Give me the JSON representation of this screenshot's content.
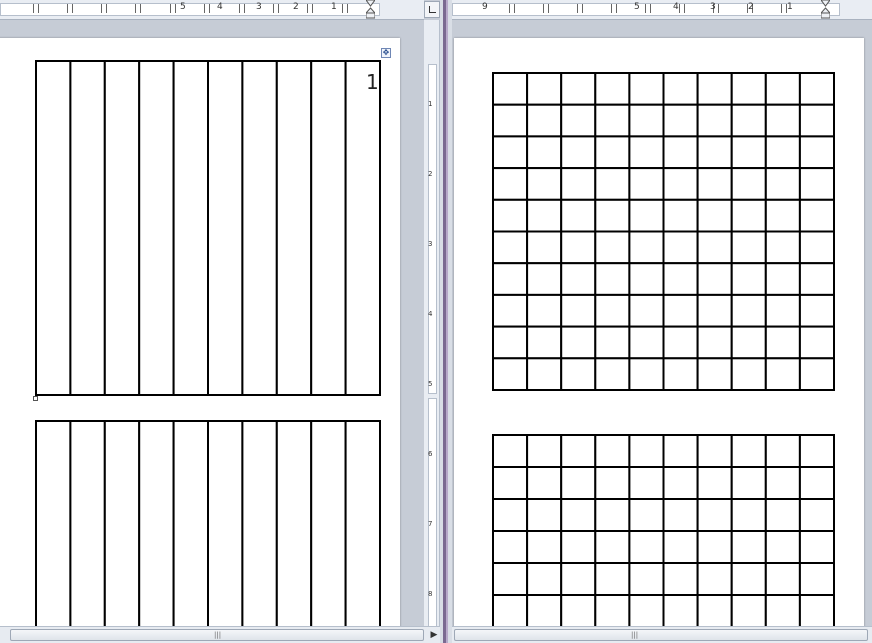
{
  "left_ruler": {
    "numbers": [
      "5",
      "4",
      "3",
      "2",
      "1"
    ]
  },
  "right_ruler": {
    "numbers": [
      "9",
      "5",
      "4",
      "3",
      "2",
      "1"
    ]
  },
  "vertical_ruler": {
    "numbers": [
      "1",
      "2",
      "3",
      "4",
      "5",
      "6",
      "7",
      "8"
    ]
  },
  "left_pane": {
    "table1": {
      "columns": 10,
      "rows": 1,
      "cell_text": "1"
    },
    "table2": {
      "columns": 10,
      "rows": 1
    }
  },
  "right_pane": {
    "table1": {
      "columns": 10,
      "rows": 10
    },
    "table2": {
      "columns": 10,
      "rows": 6
    }
  },
  "scrollbar": {
    "grip": "|||",
    "right_arrow": "▶"
  },
  "icons": {
    "move_handle": "move-icon",
    "resize_handle": "resize-square-icon",
    "view_ruler": "view-ruler-icon"
  }
}
